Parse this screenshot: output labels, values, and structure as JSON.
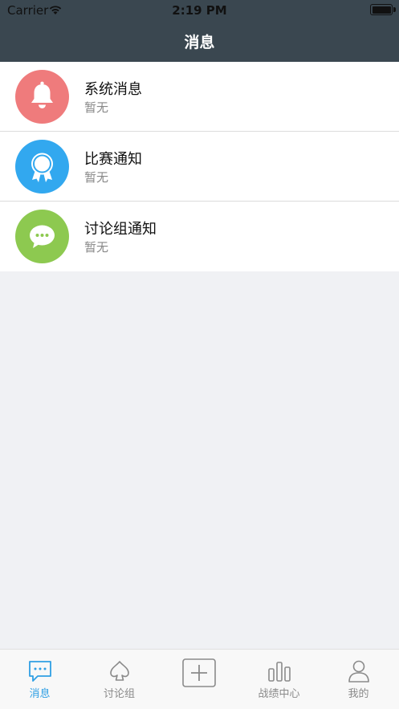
{
  "status_bar": {
    "carrier": "Carrier",
    "time": "2:19 PM"
  },
  "nav": {
    "title": "消息"
  },
  "messages": [
    {
      "name": "系统消息",
      "sub": "暂无",
      "icon": "bell-icon",
      "color": "#ef7b7c"
    },
    {
      "name": "比赛通知",
      "sub": "暂无",
      "icon": "award-ribbon-icon",
      "color": "#32a8ef"
    },
    {
      "name": "讨论组通知",
      "sub": "暂无",
      "icon": "chat-bubble-icon",
      "color": "#8dc950"
    }
  ],
  "tabs": [
    {
      "label": "消息",
      "icon": "message-icon",
      "active": true
    },
    {
      "label": "讨论组",
      "icon": "spade-icon",
      "active": false
    },
    {
      "label": "",
      "icon": "plus-icon",
      "active": false
    },
    {
      "label": "战绩中心",
      "icon": "bar-chart-icon",
      "active": false
    },
    {
      "label": "我的",
      "icon": "person-icon",
      "active": false
    }
  ],
  "colors": {
    "header": "#3a4750",
    "active_tab": "#2f9fe4",
    "background": "#f0f1f4"
  }
}
